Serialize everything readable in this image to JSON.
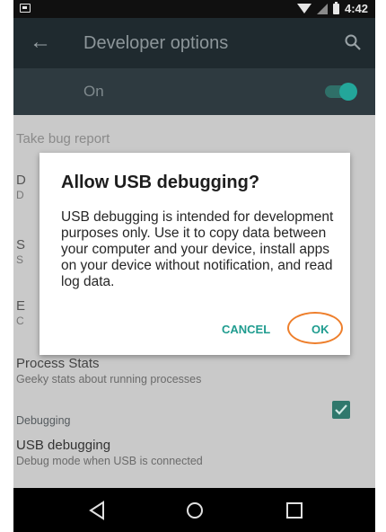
{
  "statusbar": {
    "time": "4:42"
  },
  "toolbar": {
    "title": "Developer options",
    "icons": [
      "back-arrow-icon",
      "search-icon"
    ]
  },
  "master_switch": {
    "label": "On",
    "state": "on"
  },
  "settings": {
    "take_bug_report": "Take bug report",
    "partial_rows": [
      {
        "title": "D",
        "subtitle": "D"
      },
      {
        "title": "S",
        "subtitle": "S"
      },
      {
        "title": "E",
        "subtitle": "C"
      }
    ],
    "process_stats": {
      "title": "Process Stats",
      "subtitle": "Geeky stats about running processes"
    },
    "debugging_header": "Debugging",
    "usb_debugging": {
      "title": "USB debugging",
      "subtitle": "Debug mode when USB is connected",
      "checked": true
    }
  },
  "dialog": {
    "title": "Allow USB debugging?",
    "body": "USB debugging is intended for development purposes only. Use it to copy data between your computer and your device, install apps on your device without notification, and read log data.",
    "cancel_label": "CANCEL",
    "ok_label": "OK",
    "highlight_color": "#ee7f2c"
  },
  "colors": {
    "accent": "#1f9c8f",
    "toolbar": "#1f2a2f"
  }
}
